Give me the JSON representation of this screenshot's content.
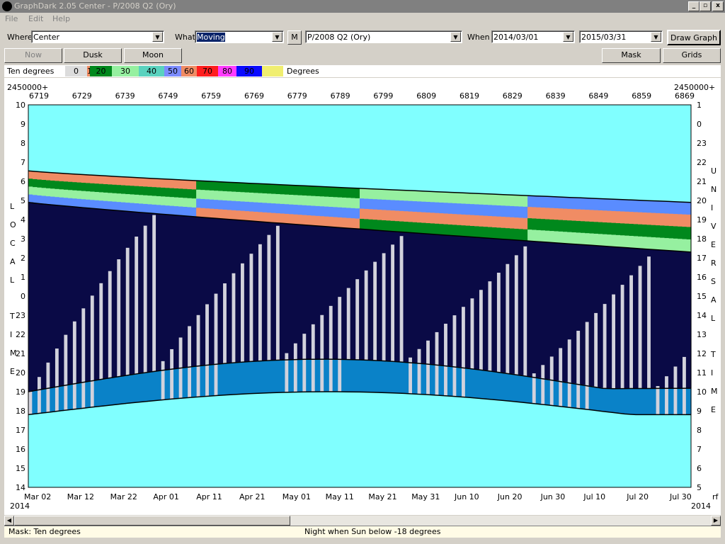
{
  "window": {
    "title": "GraphDark 2.05  Center  -  P/2008 Q2 (Ory)",
    "buttons": [
      "_",
      "▫",
      "x"
    ]
  },
  "menu": [
    "File",
    "Edit",
    "Help"
  ],
  "toolbar": {
    "where_label": "Where",
    "where_value": "Center",
    "what_label": "What",
    "what_value": "Moving",
    "m_button": "M",
    "object_value": "P/2008 Q2 (Ory)",
    "when_label": "When",
    "start_date": "2014/03/01",
    "end_date": "2015/03/31",
    "draw_button": "Draw Graph"
  },
  "buttons_row": {
    "now": "Now",
    "dusk": "Dusk",
    "moon": "Moon",
    "mask": "Mask",
    "grids": "Grids"
  },
  "legend": {
    "title": "Ten degrees",
    "units": "Degrees",
    "swatches": [
      {
        "label": "0",
        "color": "#dcdcdc"
      },
      {
        "label": "10",
        "color": "#f08c64"
      },
      {
        "label": "20",
        "color": "#00881c"
      },
      {
        "label": "30",
        "color": "#96f0a0"
      },
      {
        "label": "40",
        "color": "#5ad2be"
      },
      {
        "label": "50",
        "color": "#7c8cff"
      },
      {
        "label": "60",
        "color": "#f08c64"
      },
      {
        "label": "70",
        "color": "#ff1e1e"
      },
      {
        "label": "80",
        "color": "#ff3cff"
      },
      {
        "label": "90",
        "color": "#0a0aff"
      },
      {
        "label": "",
        "color": "#f0ee70"
      }
    ]
  },
  "chart_data": {
    "type": "heatmap",
    "top_axis_prefix_left": "2450000+",
    "top_axis_prefix_right": "2450000+",
    "jd_ticks": [
      "6719",
      "6729",
      "6739",
      "6749",
      "6759",
      "6769",
      "6779",
      "6789",
      "6799",
      "6809",
      "6819",
      "6829",
      "6839",
      "6849",
      "6859",
      "6869"
    ],
    "date_ticks": [
      "Mar 02",
      "Mar 12",
      "Mar 22",
      "Apr 01",
      "Apr 11",
      "Apr 21",
      "May 01",
      "May 11",
      "May 21",
      "May 31",
      "Jun 10",
      "Jun 20",
      "Jun 30",
      "Jul 10",
      "Jul 20",
      "Jul 30"
    ],
    "year_left": "2014",
    "year_right": "2014",
    "bottom_right_label": "rf",
    "left_ticks": [
      "10",
      "9",
      "8",
      "7",
      "6",
      "5",
      "4",
      "3",
      "2",
      "1",
      "0",
      "23",
      "22",
      "21",
      "20",
      "19",
      "18",
      "17",
      "16",
      "15",
      "14"
    ],
    "right_ticks": [
      "1",
      "0",
      "23",
      "22",
      "21",
      "20",
      "19",
      "18",
      "17",
      "16",
      "15",
      "14",
      "13",
      "12",
      "11",
      "10",
      "9",
      "8",
      "7",
      "6",
      "5"
    ],
    "left_axis_title": "LOCAL TIME",
    "right_axis_title": "UNIVERSAL TIME",
    "colors": {
      "daylight": "#80ffff",
      "night": "#0a0a46",
      "twilight": "#0a82c8",
      "moon": "#d2d2dc",
      "alt_10": "#f08c64",
      "alt_20": "#00881c",
      "alt_30": "#96f0a0",
      "alt_50": "#5a8cff"
    }
  },
  "status": {
    "mask": "Mask:  Ten degrees",
    "night": "Night when Sun below -18 degrees"
  }
}
